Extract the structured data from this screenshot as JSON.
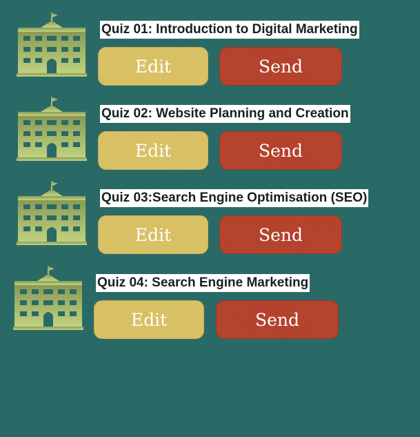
{
  "colors": {
    "background": "#2a6a66",
    "edit": "#d8bf62",
    "send": "#b33f2a",
    "icon": "#bccf7e"
  },
  "quizzes": [
    {
      "title": "Quiz 01: Introduction to Digital Marketing",
      "icon": "school-building-icon",
      "edit_label": "Edit",
      "send_label": "Send"
    },
    {
      "title": "Quiz 02: Website Planning and Creation",
      "icon": "school-building-icon",
      "edit_label": "Edit",
      "send_label": "Send"
    },
    {
      "title": "Quiz 03:Search Engine Optimisation (SEO)",
      "icon": "school-building-icon",
      "edit_label": "Edit",
      "send_label": "Send"
    },
    {
      "title": "Quiz 04: Search Engine Marketing",
      "icon": "school-building-icon",
      "edit_label": "Edit",
      "send_label": "Send"
    }
  ]
}
